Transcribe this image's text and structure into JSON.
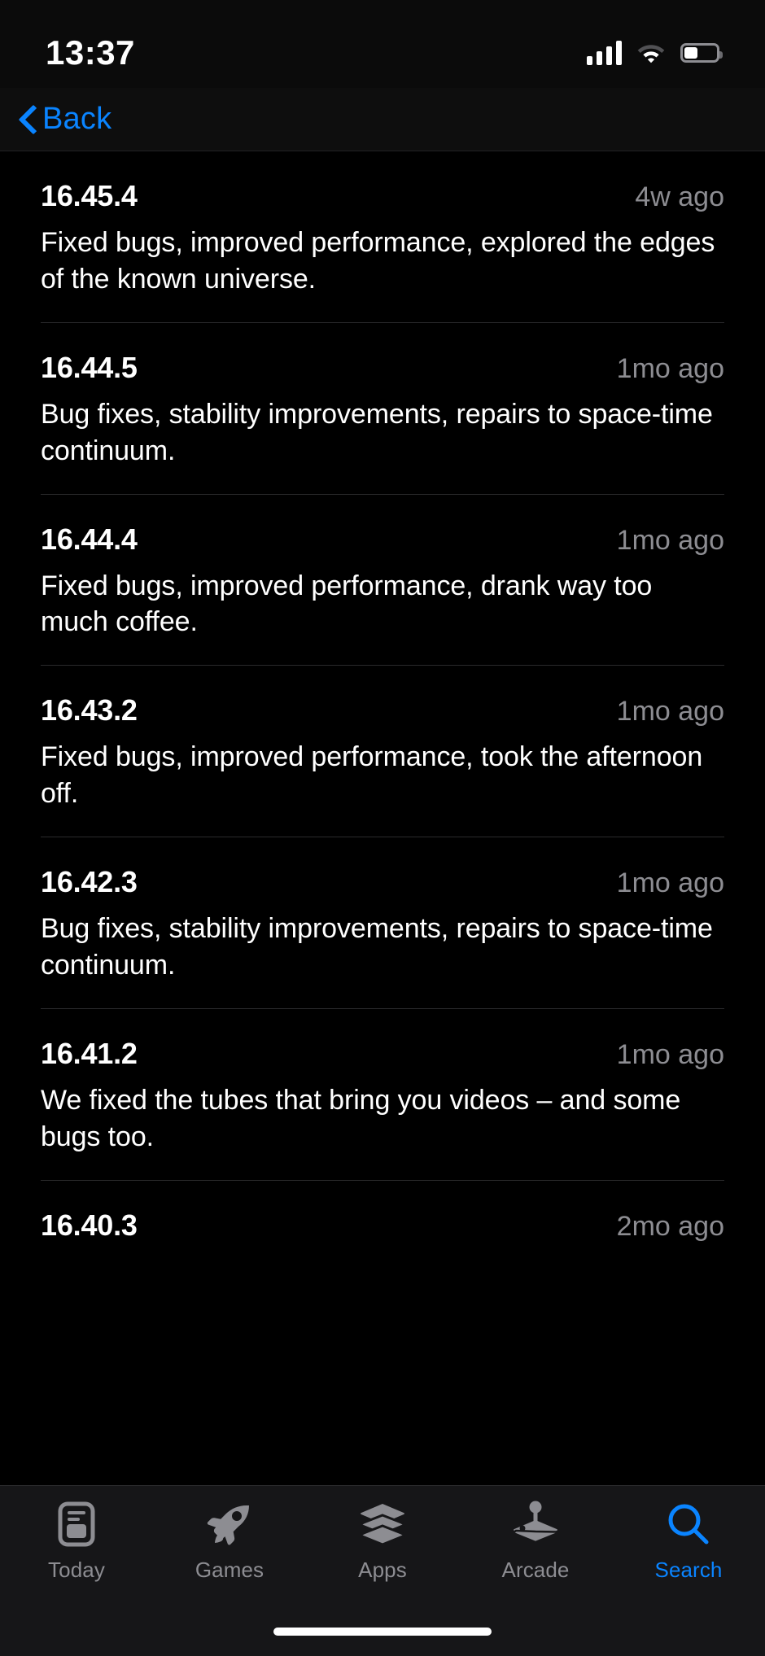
{
  "status_bar": {
    "time": "13:37",
    "signal_icon": "cellular-signal-icon",
    "signal_bars_active": 4,
    "wifi_icon": "wifi-icon",
    "battery_icon": "battery-icon",
    "battery_percent": 42
  },
  "nav": {
    "back_label": "Back",
    "back_icon": "chevron-left-icon",
    "accent_color": "#0a84ff"
  },
  "versions": [
    {
      "number": "16.45.4",
      "age": "4w ago",
      "notes": "Fixed bugs, improved performance, explored the edges of the known universe."
    },
    {
      "number": "16.44.5",
      "age": "1mo ago",
      "notes": "Bug fixes, stability improvements, repairs to space-time continuum."
    },
    {
      "number": "16.44.4",
      "age": "1mo ago",
      "notes": "Fixed bugs, improved performance, drank way too much coffee."
    },
    {
      "number": "16.43.2",
      "age": "1mo ago",
      "notes": "Fixed bugs, improved performance, took the afternoon off."
    },
    {
      "number": "16.42.3",
      "age": "1mo ago",
      "notes": "Bug fixes, stability improvements, repairs to space-time continuum."
    },
    {
      "number": "16.41.2",
      "age": "1mo ago",
      "notes": "We fixed the tubes that bring you videos – and some bugs too."
    },
    {
      "number": "16.40.3",
      "age": "2mo ago",
      "notes": ""
    }
  ],
  "tab_bar": {
    "active_index": 4,
    "items": [
      {
        "label": "Today",
        "icon": "today-card-icon"
      },
      {
        "label": "Games",
        "icon": "rocket-icon"
      },
      {
        "label": "Apps",
        "icon": "stacked-layers-icon"
      },
      {
        "label": "Arcade",
        "icon": "joystick-icon"
      },
      {
        "label": "Search",
        "icon": "magnifier-icon"
      }
    ],
    "inactive_color": "#8d8d92",
    "active_color": "#0a84ff"
  },
  "home_indicator": "home-indicator-bar"
}
